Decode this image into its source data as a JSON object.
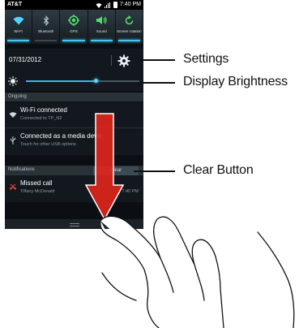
{
  "status_bar": {
    "carrier": "AT&T",
    "time": "7:40 PM"
  },
  "quick_toggles": [
    {
      "label": "Wi-Fi",
      "icon": "wifi-icon",
      "active": true
    },
    {
      "label": "Bluetooth",
      "icon": "bluetooth-icon",
      "active": false
    },
    {
      "label": "GPS",
      "icon": "gps-icon",
      "active": true
    },
    {
      "label": "Sound",
      "icon": "sound-icon",
      "active": true
    },
    {
      "label": "Screen rotation",
      "icon": "rotation-icon",
      "active": true
    }
  ],
  "date": "07/31/2012",
  "brightness": {
    "level": 0.62
  },
  "sections": {
    "ongoing": "Ongoing",
    "notifications": "Notifications"
  },
  "notifications_ongoing": [
    {
      "title": "Wi-Fi connected",
      "subtitle": "Connected to TP_N2",
      "icon": "wifi-icon"
    },
    {
      "title": "Connected as a media devic",
      "subtitle": "Touch for other USB options",
      "icon": "usb-icon"
    }
  ],
  "notifications": [
    {
      "title": "Missed call",
      "subtitle": "Tiffany McDonald",
      "time": "7:40 PM",
      "icon": "missed-call-icon"
    }
  ],
  "clear_button": {
    "label": "Clear"
  },
  "callouts": {
    "settings": "Settings",
    "brightness": "Display Brightness",
    "clear": "Clear Button"
  },
  "colors": {
    "accent": "#43c8f1",
    "arrow": "#e1261c"
  }
}
